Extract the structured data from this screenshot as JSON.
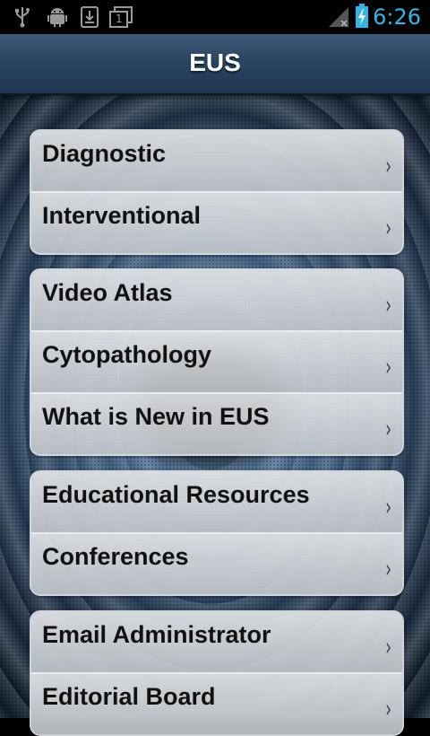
{
  "status_bar": {
    "time": "6:26",
    "icons": [
      "usb-icon",
      "android-debug-icon",
      "download-icon",
      "notification-badge-icon",
      "signal-icon",
      "battery-charging-icon"
    ],
    "badge_number": "1"
  },
  "header": {
    "title": "EUS"
  },
  "menu": {
    "groups": [
      {
        "items": [
          {
            "label": "Diagnostic"
          },
          {
            "label": "Interventional"
          }
        ]
      },
      {
        "items": [
          {
            "label": "Video Atlas"
          },
          {
            "label": "Cytopathology"
          },
          {
            "label": "What is New in EUS"
          }
        ]
      },
      {
        "items": [
          {
            "label": "Educational Resources"
          },
          {
            "label": "Conferences"
          }
        ]
      },
      {
        "items": [
          {
            "label": "Email Administrator"
          },
          {
            "label": "Editorial Board"
          }
        ]
      }
    ],
    "chevron": "›"
  },
  "colors": {
    "accent": "#33b5e5",
    "titlebar": "#2b4563"
  }
}
